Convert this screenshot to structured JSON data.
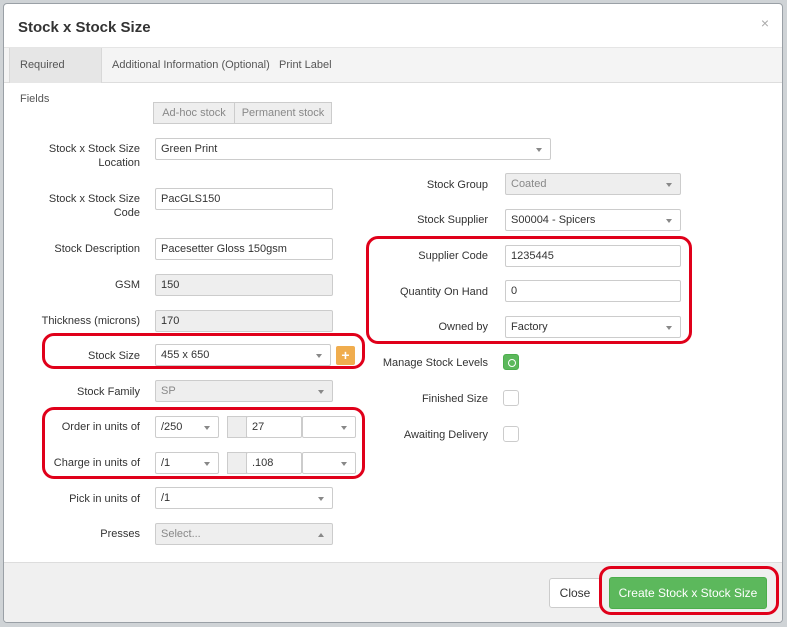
{
  "modal": {
    "title": "Stock x Stock Size",
    "close_glyph": "×"
  },
  "tabs": [
    "Required Fields",
    "Additional Information (Optional)",
    "Print Label"
  ],
  "stock_type": {
    "adhoc": "Ad-hoc stock",
    "permanent": "Permanent stock"
  },
  "left": {
    "location_label_1": "Stock x Stock Size",
    "location_label_2": "Location",
    "location_value": "Green Print",
    "code_label_1": "Stock x Stock Size",
    "code_label_2": "Code",
    "code_value": "PacGLS150",
    "desc_label": "Stock Description",
    "desc_value": "Pacesetter Gloss 150gsm",
    "gsm_label": "GSM",
    "gsm_value": "150",
    "thickness_label": "Thickness (microns)",
    "thickness_value": "170",
    "size_label": "Stock Size",
    "size_value": "455 x 650",
    "family_label": "Stock Family",
    "family_value": "SP",
    "order_label": "Order in units of",
    "order_unit": "/250",
    "order_value": "27",
    "charge_label": "Charge in units of",
    "charge_unit": "/1",
    "charge_value": ".108",
    "pick_label": "Pick in units of",
    "pick_value": "/1",
    "presses_label": "Presses",
    "presses_placeholder": "Select..."
  },
  "right": {
    "group_label": "Stock Group",
    "group_value": "Coated",
    "supplier_label": "Stock Supplier",
    "supplier_value": "S00004 - Spicers",
    "supplier_code_label": "Supplier Code",
    "supplier_code_value": "1235445",
    "qty_label": "Quantity On Hand",
    "qty_value": "0",
    "owned_label": "Owned by",
    "owned_value": "Factory",
    "manage_label": "Manage Stock Levels",
    "finished_label": "Finished Size",
    "awaiting_label": "Awaiting Delivery"
  },
  "footer": {
    "close_label": "Close",
    "create_label": "Create Stock x Stock Size"
  },
  "colors": {
    "primary_green": "#5cb85c",
    "warning_orange": "#f0ad4e",
    "highlight_red": "#e0001a"
  },
  "icons": {
    "close": "close-icon",
    "add": "plus-icon",
    "dropdown": "chevron-down-icon"
  }
}
